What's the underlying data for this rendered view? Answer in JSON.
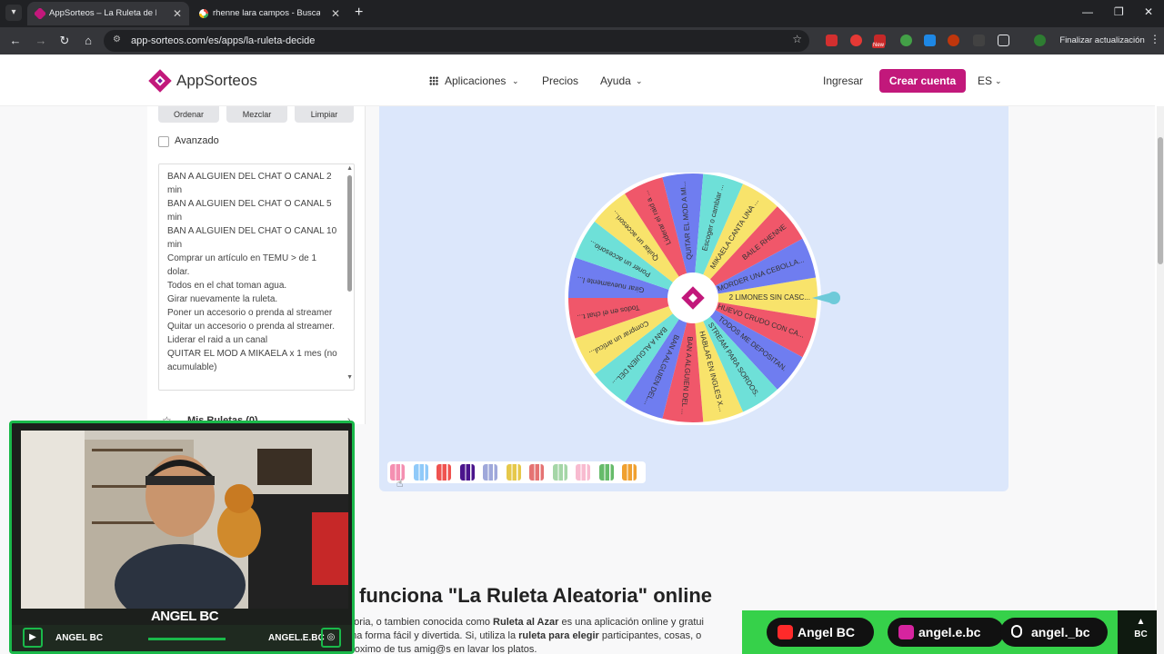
{
  "browser": {
    "tabs": [
      {
        "title": "AppSorteos – La Ruleta de la Su",
        "active": true
      },
      {
        "title": "rhenne lara campos - Buscar co",
        "active": false
      }
    ],
    "url": "app-sorteos.com/es/apps/la-ruleta-decide",
    "update_button": "Finalizar actualización",
    "ext_badge": "New"
  },
  "site": {
    "brand": "AppSorteos",
    "nav": {
      "apps": "Aplicaciones",
      "prices": "Precios",
      "help": "Ayuda"
    },
    "login": "Ingresar",
    "signup": "Crear cuenta",
    "lang": "ES",
    "brand_color": "#c2187b"
  },
  "panel": {
    "buttons": {
      "sort": "Ordenar",
      "shuffle": "Mezclar",
      "clear": "Limpiar"
    },
    "advanced_label": "Avanzado",
    "entries": [
      "BAN A ALGUIEN DEL CHAT O CANAL 2 min",
      "BAN A ALGUIEN DEL CHAT O CANAL 5 min",
      "BAN A ALGUIEN DEL CHAT O CANAL 10 min",
      "Comprar un artículo en TEMU > de 1 dolar.",
      "Todos en el chat toman agua.",
      "Girar nuevamente la ruleta.",
      "Poner un accesorio o prenda al streamer",
      "Quitar un accesorio o prenda al streamer.",
      "Liderar el raid a un canal",
      "QUITAR EL MOD A MIKAELA x 1 mes (no acumulable)"
    ],
    "my_wheels": "Mis Ruletas",
    "my_wheels_count": "(0)"
  },
  "wheel": {
    "segments": [
      {
        "label": "2 LIMONES SIN CASC...",
        "color": "#f8e36b"
      },
      {
        "label": "HUEVO CRUDO CON CA...",
        "color": "#f0576a"
      },
      {
        "label": "TODOS ME DEPOSITAN.",
        "color": "#6f7df0"
      },
      {
        "label": "STREAM PARA SORDOS.",
        "color": "#6ee0d8"
      },
      {
        "label": "HABLAR EN INGLES X...",
        "color": "#f8e36b"
      },
      {
        "label": "BAN A ALGUIEN DEL ...",
        "color": "#f0576a"
      },
      {
        "label": "BAN A ALGUIEN DEL...",
        "color": "#6f7df0"
      },
      {
        "label": "BAN A ALGUIEN DEL...",
        "color": "#6ee0d8"
      },
      {
        "label": "Comprar un artícul...",
        "color": "#f8e36b"
      },
      {
        "label": "Todos en el chat t...",
        "color": "#f0576a"
      },
      {
        "label": "Girar nuevamente l...",
        "color": "#6f7df0"
      },
      {
        "label": "Poner un accesorio...",
        "color": "#6ee0d8"
      },
      {
        "label": "Quitar un accesori...",
        "color": "#f8e36b"
      },
      {
        "label": "Liderar el raid a ...",
        "color": "#f0576a"
      },
      {
        "label": "QUITAR EL MOD A MI...",
        "color": "#6f7df0"
      },
      {
        "label": "Escoger o cambiar ...",
        "color": "#6ee0d8"
      },
      {
        "label": "MIKAELA CANTA UNA ...",
        "color": "#f8e36b"
      },
      {
        "label": "BAILE RHENNE",
        "color": "#f0576a"
      },
      {
        "label": "MORDER UNA CEBOLLA...",
        "color": "#6f7df0"
      }
    ],
    "center_color": "#c2187b",
    "pointer_color": "#6ecad9"
  },
  "palette": [
    "#f48fb1",
    "#90caf9",
    "#ef5350",
    "#4a148c",
    "#9fa8da",
    "#e6c84a",
    "#e57373",
    "#a5d6a7",
    "#f8bbd0",
    "#66bb6a",
    "#f0a030"
  ],
  "content": {
    "heading": "funciona \"La Ruleta Aleatoria\" online",
    "para_1": "atoria, o tambien conocida como ",
    "para_bold_1": "Ruleta al Azar",
    "para_2": " es una aplicación online y gratui",
    "para_3": "una forma fácil y divertida. Si, utiliza la ",
    "para_bold_2": "ruleta para elegir",
    "para_4": " participantes, cosas, o",
    "para_5": "proximo de tus amig@s en lavar los platos."
  },
  "stream": {
    "name": "ANGEL BC",
    "left_handle": "ANGEL BC",
    "right_handle": "ANGEL.E.BC",
    "socials": [
      {
        "icon": "youtube-icon",
        "handle": "Angel BC",
        "color": "#ff2a2a"
      },
      {
        "icon": "instagram-icon",
        "handle": "angel.e.bc",
        "color": "#d6249f"
      },
      {
        "icon": "tiktok-icon",
        "handle": "angel._bc",
        "color": "#ffffff"
      }
    ],
    "accent": "#1ab94a",
    "corner_logo": "BC"
  }
}
